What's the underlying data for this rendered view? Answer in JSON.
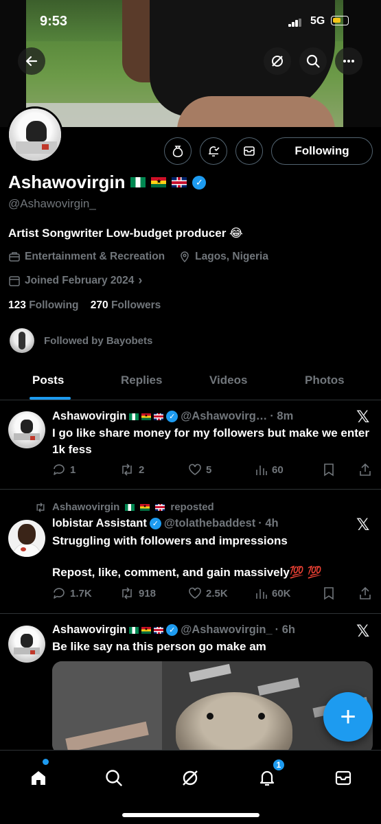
{
  "status_bar": {
    "time": "9:53",
    "network": "5G"
  },
  "profile": {
    "name": "Ashawovirgin",
    "handle": "@Ashawovirgin_",
    "bio": "Artist Songwriter Low-budget producer 😂",
    "category": "Entertainment & Recreation",
    "location": "Lagos, Nigeria",
    "joined": "Joined February 2024",
    "following_count": "123",
    "following_label": "Following",
    "followers_count": "270",
    "followers_label": "Followers",
    "followed_by": "Followed by Bayobets",
    "follow_button": "Following"
  },
  "tabs": [
    "Posts",
    "Replies",
    "Videos",
    "Photos"
  ],
  "posts": [
    {
      "name": "Ashawovirgin",
      "handle": "@Ashawovirg…",
      "time": "· 8m",
      "text": "I go like share money for my followers but make we enter 1k fess",
      "replies": "1",
      "reposts": "2",
      "likes": "5",
      "views": "60"
    },
    {
      "repost_by": "Ashawovirgin",
      "repost_label": "reposted",
      "name": "lobistar Assistant",
      "handle": "@tolathebaddest",
      "time": "· 4h",
      "text_line1": "Struggling with followers and impressions",
      "text_line2": "Repost, like, comment, and gain massively💯 💯",
      "replies": "1.7K",
      "reposts": "918",
      "likes": "2.5K",
      "views": "60K"
    },
    {
      "name": "Ashawovirgin",
      "handle": "@Ashawovirgin_",
      "time": "· 6h",
      "text": "Be like say na this person go make am"
    }
  ],
  "notifications_badge": "1",
  "colors": {
    "accent": "#1d9bf0",
    "background": "#000000",
    "muted": "#71767b"
  }
}
